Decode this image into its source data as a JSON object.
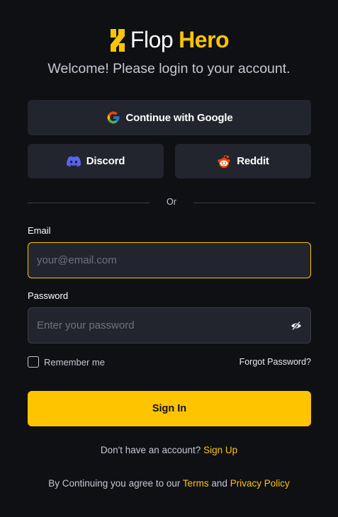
{
  "brand": {
    "name_part1": "Flop",
    "name_part2": "Hero",
    "accent_color": "#ffc400"
  },
  "subtitle": "Welcome! Please login to your account.",
  "social": {
    "google": {
      "label": "Continue with Google",
      "icon": "google-icon"
    },
    "discord": {
      "label": "Discord",
      "icon": "discord-icon"
    },
    "reddit": {
      "label": "Reddit",
      "icon": "reddit-icon"
    }
  },
  "divider_text": "Or",
  "form": {
    "email": {
      "label": "Email",
      "placeholder": "your@email.com",
      "value": ""
    },
    "password": {
      "label": "Password",
      "placeholder": "Enter your password",
      "value": "",
      "toggle_icon": "eye-off-icon"
    },
    "remember_label": "Remember me",
    "remember_checked": false,
    "forgot_label": "Forgot Password?",
    "submit_label": "Sign In"
  },
  "signup": {
    "prompt": "Don't have an account?",
    "link": "Sign Up"
  },
  "legal": {
    "prefix": "By Continuing you agree to our",
    "terms": "Terms",
    "and": "and",
    "privacy": "Privacy Policy"
  },
  "colors": {
    "background": "#0f1014",
    "surface": "#22252d",
    "discord": "#5865f2",
    "reddit": "#ff4500"
  }
}
